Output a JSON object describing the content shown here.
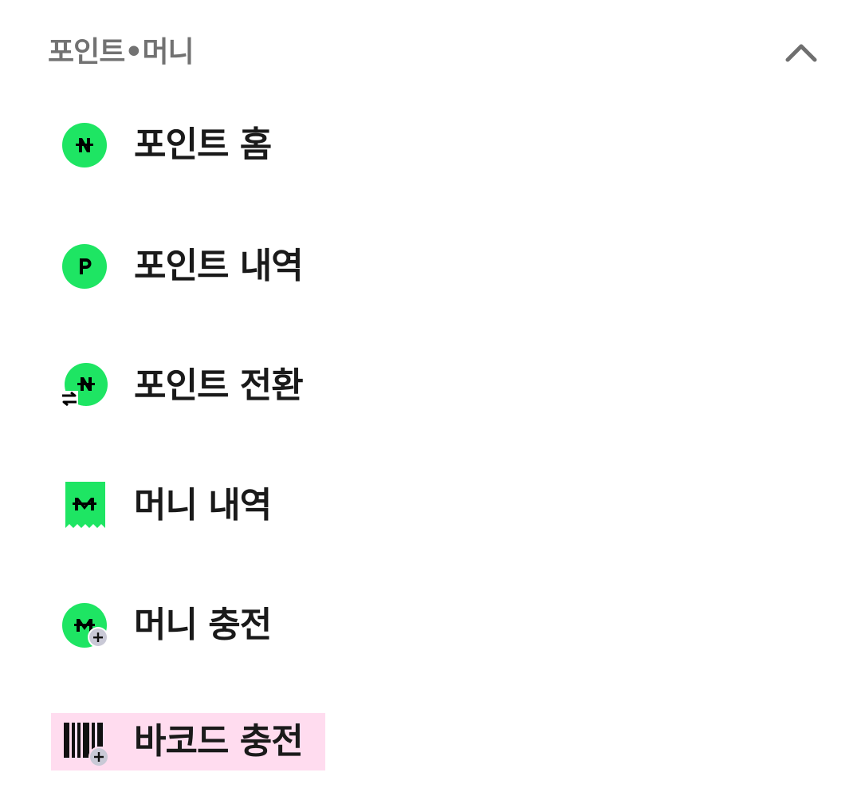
{
  "section": {
    "title": "포인트•머니",
    "expanded": true
  },
  "colors": {
    "accent": "#1ee563",
    "title_gray": "#727272",
    "text_dark": "#1a1a1a",
    "highlight": "#ffdcef",
    "badge_gray": "#c9c9d6"
  },
  "items": [
    {
      "label": "포인트 홈",
      "icon": "naver-pay-n-icon"
    },
    {
      "label": "포인트 내역",
      "icon": "point-p-icon"
    },
    {
      "label": "포인트 전환",
      "icon": "point-transfer-icon"
    },
    {
      "label": "머니 내역",
      "icon": "money-receipt-icon"
    },
    {
      "label": "머니 충전",
      "icon": "money-charge-icon"
    },
    {
      "label": "바코드 충전",
      "icon": "barcode-charge-icon",
      "highlighted": true
    }
  ]
}
